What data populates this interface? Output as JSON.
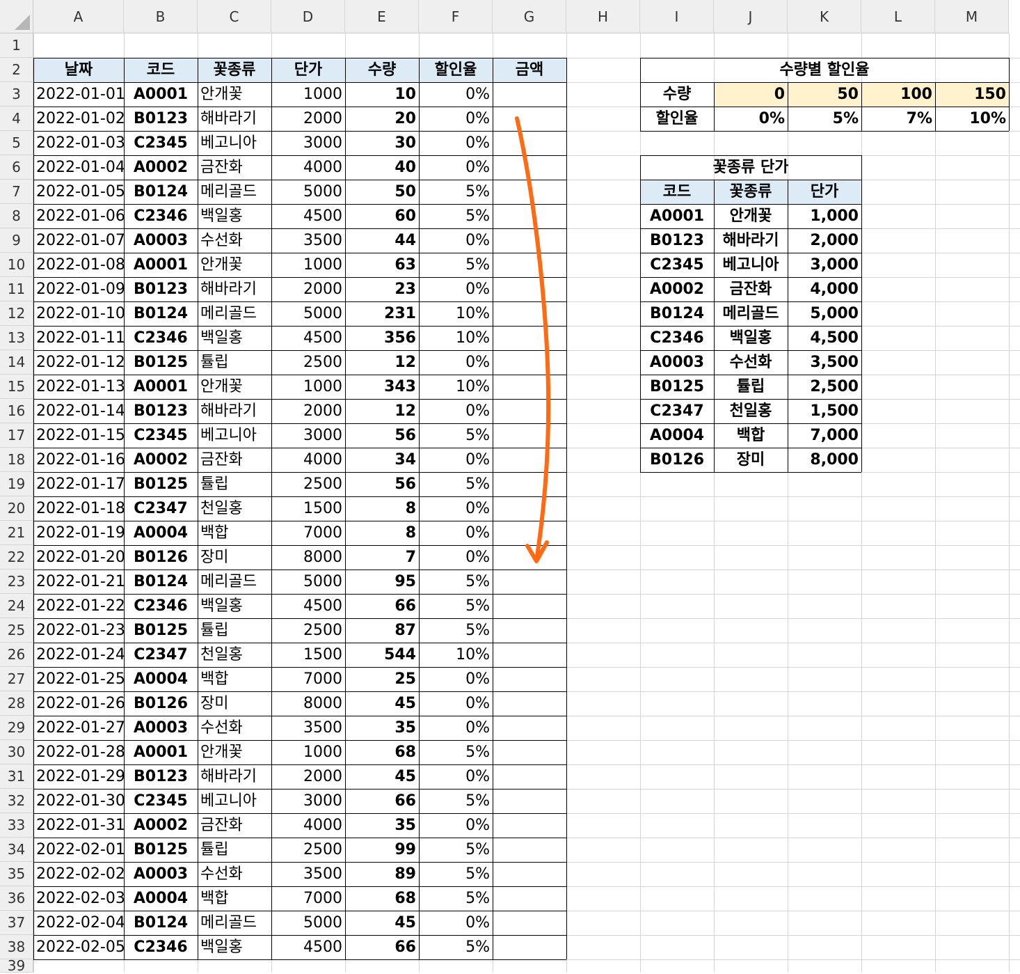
{
  "columns": [
    "A",
    "B",
    "C",
    "D",
    "E",
    "F",
    "G",
    "H",
    "I",
    "J",
    "K",
    "L",
    "M"
  ],
  "rows": [
    "1",
    "2",
    "3",
    "4",
    "5",
    "6",
    "7",
    "8",
    "9",
    "10",
    "11",
    "12",
    "13",
    "14",
    "15",
    "16",
    "17",
    "18",
    "19",
    "20",
    "21",
    "22",
    "23",
    "24",
    "25",
    "26",
    "27",
    "28",
    "29",
    "30",
    "31",
    "32",
    "33",
    "34",
    "35",
    "36",
    "37",
    "38",
    "39"
  ],
  "main_table": {
    "headers": [
      "날짜",
      "코드",
      "꽃종류",
      "단가",
      "수량",
      "할인율",
      "금액"
    ],
    "rows": [
      [
        "2022-01-01",
        "A0001",
        "안개꽃",
        "1000",
        "10",
        "0%",
        ""
      ],
      [
        "2022-01-02",
        "B0123",
        "해바라기",
        "2000",
        "20",
        "0%",
        ""
      ],
      [
        "2022-01-03",
        "C2345",
        "베고니아",
        "3000",
        "30",
        "0%",
        ""
      ],
      [
        "2022-01-04",
        "A0002",
        "금잔화",
        "4000",
        "40",
        "0%",
        ""
      ],
      [
        "2022-01-05",
        "B0124",
        "메리골드",
        "5000",
        "50",
        "5%",
        ""
      ],
      [
        "2022-01-06",
        "C2346",
        "백일홍",
        "4500",
        "60",
        "5%",
        ""
      ],
      [
        "2022-01-07",
        "A0003",
        "수선화",
        "3500",
        "44",
        "0%",
        ""
      ],
      [
        "2022-01-08",
        "A0001",
        "안개꽃",
        "1000",
        "63",
        "5%",
        ""
      ],
      [
        "2022-01-09",
        "B0123",
        "해바라기",
        "2000",
        "23",
        "0%",
        ""
      ],
      [
        "2022-01-10",
        "B0124",
        "메리골드",
        "5000",
        "231",
        "10%",
        ""
      ],
      [
        "2022-01-11",
        "C2346",
        "백일홍",
        "4500",
        "356",
        "10%",
        ""
      ],
      [
        "2022-01-12",
        "B0125",
        "튤립",
        "2500",
        "12",
        "0%",
        ""
      ],
      [
        "2022-01-13",
        "A0001",
        "안개꽃",
        "1000",
        "343",
        "10%",
        ""
      ],
      [
        "2022-01-14",
        "B0123",
        "해바라기",
        "2000",
        "12",
        "0%",
        ""
      ],
      [
        "2022-01-15",
        "C2345",
        "베고니아",
        "3000",
        "56",
        "5%",
        ""
      ],
      [
        "2022-01-16",
        "A0002",
        "금잔화",
        "4000",
        "34",
        "0%",
        ""
      ],
      [
        "2022-01-17",
        "B0125",
        "튤립",
        "2500",
        "56",
        "5%",
        ""
      ],
      [
        "2022-01-18",
        "C2347",
        "천일홍",
        "1500",
        "8",
        "0%",
        ""
      ],
      [
        "2022-01-19",
        "A0004",
        "백합",
        "7000",
        "8",
        "0%",
        ""
      ],
      [
        "2022-01-20",
        "B0126",
        "장미",
        "8000",
        "7",
        "0%",
        ""
      ],
      [
        "2022-01-21",
        "B0124",
        "메리골드",
        "5000",
        "95",
        "5%",
        ""
      ],
      [
        "2022-01-22",
        "C2346",
        "백일홍",
        "4500",
        "66",
        "5%",
        ""
      ],
      [
        "2022-01-23",
        "B0125",
        "튤립",
        "2500",
        "87",
        "5%",
        ""
      ],
      [
        "2022-01-24",
        "C2347",
        "천일홍",
        "1500",
        "544",
        "10%",
        ""
      ],
      [
        "2022-01-25",
        "A0004",
        "백합",
        "7000",
        "25",
        "0%",
        ""
      ],
      [
        "2022-01-26",
        "B0126",
        "장미",
        "8000",
        "45",
        "0%",
        ""
      ],
      [
        "2022-01-27",
        "A0003",
        "수선화",
        "3500",
        "35",
        "0%",
        ""
      ],
      [
        "2022-01-28",
        "A0001",
        "안개꽃",
        "1000",
        "68",
        "5%",
        ""
      ],
      [
        "2022-01-29",
        "B0123",
        "해바라기",
        "2000",
        "45",
        "0%",
        ""
      ],
      [
        "2022-01-30",
        "C2345",
        "베고니아",
        "3000",
        "66",
        "5%",
        ""
      ],
      [
        "2022-01-31",
        "A0002",
        "금잔화",
        "4000",
        "35",
        "0%",
        ""
      ],
      [
        "2022-02-01",
        "B0125",
        "튤립",
        "2500",
        "99",
        "5%",
        ""
      ],
      [
        "2022-02-02",
        "A0003",
        "수선화",
        "3500",
        "89",
        "5%",
        ""
      ],
      [
        "2022-02-03",
        "A0004",
        "백합",
        "7000",
        "68",
        "5%",
        ""
      ],
      [
        "2022-02-04",
        "B0124",
        "메리골드",
        "5000",
        "45",
        "0%",
        ""
      ],
      [
        "2022-02-05",
        "C2346",
        "백일홍",
        "4500",
        "66",
        "5%",
        ""
      ]
    ]
  },
  "discount_table": {
    "title": "수량별 할인율",
    "qty_label": "수량",
    "qty_values": [
      "0",
      "50",
      "100",
      "150"
    ],
    "rate_label": "할인율",
    "rate_values": [
      "0%",
      "5%",
      "7%",
      "10%"
    ],
    "highlight_color": "#fff2cc"
  },
  "price_table": {
    "title": "꽃종류 단가",
    "headers": [
      "코드",
      "꽃종류",
      "단가"
    ],
    "rows": [
      [
        "A0001",
        "안개꽃",
        "1,000"
      ],
      [
        "B0123",
        "해바라기",
        "2,000"
      ],
      [
        "C2345",
        "베고니아",
        "3,000"
      ],
      [
        "A0002",
        "금잔화",
        "4,000"
      ],
      [
        "B0124",
        "메리골드",
        "5,000"
      ],
      [
        "C2346",
        "백일홍",
        "4,500"
      ],
      [
        "A0003",
        "수선화",
        "3,500"
      ],
      [
        "B0125",
        "튤립",
        "2,500"
      ],
      [
        "C2347",
        "천일홍",
        "1,500"
      ],
      [
        "A0004",
        "백합",
        "7,000"
      ],
      [
        "B0126",
        "장미",
        "8,000"
      ]
    ]
  },
  "colors": {
    "header_fill": "#ddebf7",
    "annotation_arrow": "#ff6a13",
    "gridline": "#d4d4d4"
  }
}
